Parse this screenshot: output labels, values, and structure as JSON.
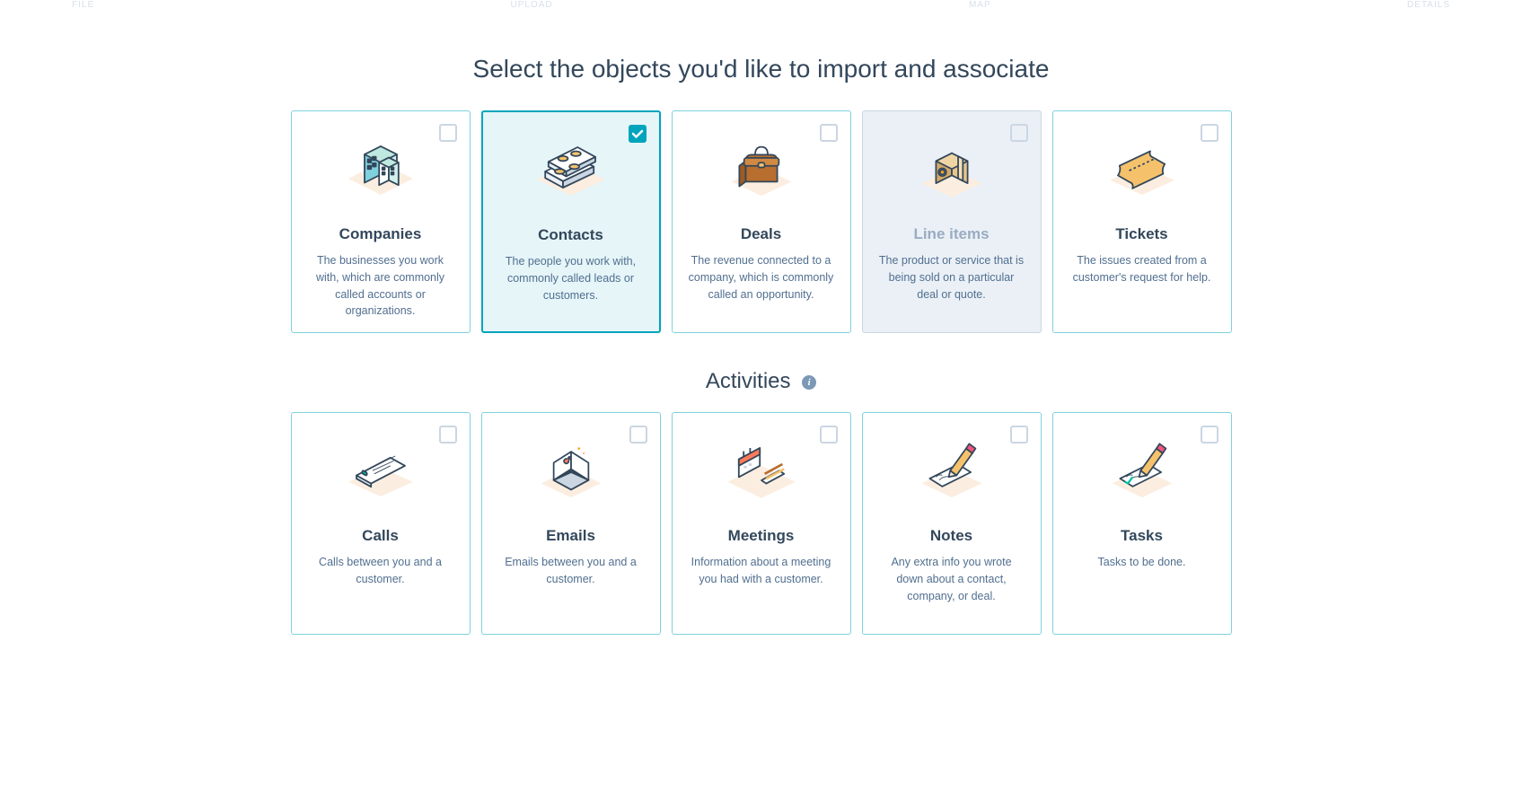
{
  "steps": [
    "FILE",
    "UPLOAD",
    "MAP",
    "DETAILS"
  ],
  "page_title": "Select the objects you'd like to import and associate",
  "section2_title": "Activities",
  "objects": [
    {
      "title": "Companies",
      "desc": "The businesses you work with, which are commonly called accounts or organizations.",
      "state": "default",
      "icon": "companies"
    },
    {
      "title": "Contacts",
      "desc": "The people you work with, commonly called leads or customers.",
      "state": "selected",
      "icon": "contacts"
    },
    {
      "title": "Deals",
      "desc": "The revenue connected to a company, which is commonly called an opportunity.",
      "state": "default",
      "icon": "deals"
    },
    {
      "title": "Line items",
      "desc": "The product or service that is being sold on a particular deal or quote.",
      "state": "disabled",
      "icon": "lineitems"
    },
    {
      "title": "Tickets",
      "desc": "The issues created from a customer's request for help.",
      "state": "default",
      "icon": "tickets"
    }
  ],
  "activities": [
    {
      "title": "Calls",
      "desc": "Calls between you and a customer.",
      "state": "default",
      "icon": "calls"
    },
    {
      "title": "Emails",
      "desc": "Emails between you and a customer.",
      "state": "default",
      "icon": "emails"
    },
    {
      "title": "Meetings",
      "desc": "Information about a meeting you had with a customer.",
      "state": "default",
      "icon": "meetings"
    },
    {
      "title": "Notes",
      "desc": "Any extra info you wrote down about a contact, company, or deal.",
      "state": "default",
      "icon": "notes"
    },
    {
      "title": "Tasks",
      "desc": "Tasks to be done.",
      "state": "default",
      "icon": "tasks"
    }
  ],
  "info_tooltip": "i"
}
